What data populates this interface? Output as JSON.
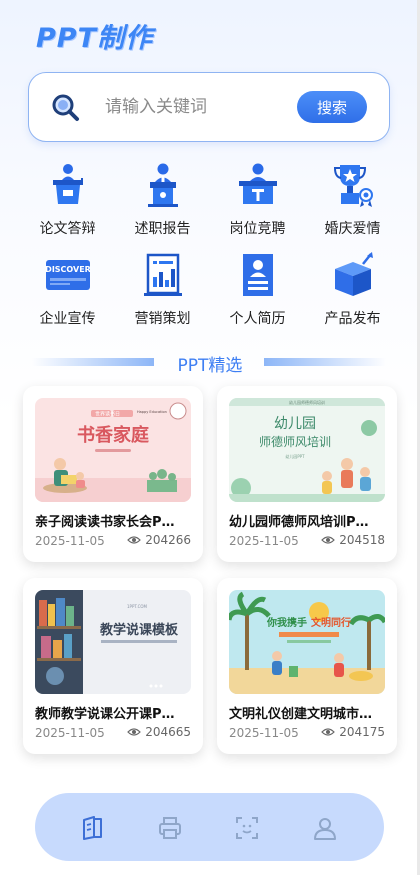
{
  "app": {
    "title": "PPT制作"
  },
  "search": {
    "placeholder": "请输入关键词",
    "button_label": "搜索"
  },
  "categories": [
    {
      "label": "论文答辩",
      "icon": "defense-icon"
    },
    {
      "label": "述职报告",
      "icon": "podium-speaker-icon"
    },
    {
      "label": "岗位竞聘",
      "icon": "interview-desk-icon"
    },
    {
      "label": "婚庆爱情",
      "icon": "trophy-icon"
    },
    {
      "label": "企业宣传",
      "icon": "discover-card-icon"
    },
    {
      "label": "营销策划",
      "icon": "report-chart-icon"
    },
    {
      "label": "个人简历",
      "icon": "resume-icon"
    },
    {
      "label": "产品发布",
      "icon": "product-box-icon"
    }
  ],
  "section": {
    "title": "PPT精选"
  },
  "cards": [
    {
      "title": "亲子阅读读书家长会P…",
      "date": "2025-11-05",
      "views": "204266",
      "thumb_title": "书香家庭",
      "thumb_top": "世界读书日",
      "thumb_brand": "Happy Education"
    },
    {
      "title": "幼儿园师德师风培训P…",
      "date": "2025-11-05",
      "views": "204518",
      "thumb_top": "幼儿园师德师风培训",
      "thumb_title_1": "幼儿园",
      "thumb_title_2": "师德师风培训",
      "thumb_small": "幼儿园PPT"
    },
    {
      "title": "教师教学说课公开课P…",
      "date": "2025-11-05",
      "views": "204665",
      "thumb_top": "1PPT.COM",
      "thumb_title": "教学说课模板"
    },
    {
      "title": "文明礼仪创建文明城市…",
      "date": "2025-11-05",
      "views": "204175",
      "thumb_title_1": "你我携手",
      "thumb_title_2": "文明同行"
    }
  ],
  "nav": [
    {
      "name": "nav-templates",
      "icon": "book-icon",
      "active": true
    },
    {
      "name": "nav-print",
      "icon": "printer-icon",
      "active": false
    },
    {
      "name": "nav-scan",
      "icon": "scan-icon",
      "active": false
    },
    {
      "name": "nav-profile",
      "icon": "user-icon",
      "active": false
    }
  ],
  "colors": {
    "accent": "#3e7ff3",
    "nav_bg": "#c7dafd",
    "nav_active": "#3d6fd6",
    "nav_inactive": "#8fa6c9"
  }
}
